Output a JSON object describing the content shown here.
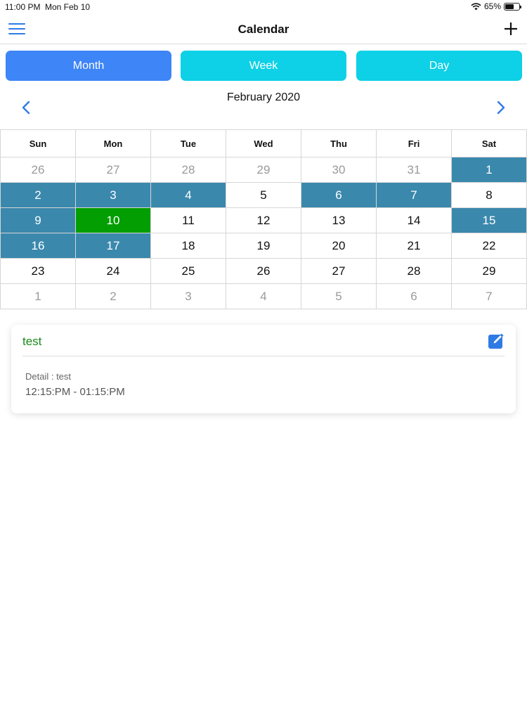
{
  "status_bar": {
    "time": "11:00 PM",
    "date": "Mon Feb 10",
    "battery": "65%",
    "battery_level": 0.65,
    "icons": [
      "wifi-icon",
      "battery-icon"
    ]
  },
  "nav": {
    "title": "Calendar",
    "left_icon": "hamburger-menu-icon",
    "right_icon": "plus-icon"
  },
  "tabs": [
    {
      "label": "Month",
      "selected": true,
      "color": "#3e85f7"
    },
    {
      "label": "Week",
      "selected": false,
      "color": "#0ed0e6"
    },
    {
      "label": "Day",
      "selected": false,
      "color": "#0ed0e6"
    }
  ],
  "month_nav": {
    "title": "February 2020",
    "prev_icon": "chevron-left-icon",
    "next_icon": "chevron-right-icon"
  },
  "calendar": {
    "weekdays": [
      "Sun",
      "Mon",
      "Tue",
      "Wed",
      "Thu",
      "Fri",
      "Sat"
    ],
    "colors": {
      "event": "#3b88ad",
      "today": "#029e02",
      "muted": "#9a9a9a"
    },
    "weeks": [
      [
        {
          "day": "26",
          "state": "muted"
        },
        {
          "day": "27",
          "state": "muted"
        },
        {
          "day": "28",
          "state": "muted"
        },
        {
          "day": "29",
          "state": "muted"
        },
        {
          "day": "30",
          "state": "muted"
        },
        {
          "day": "31",
          "state": "muted"
        },
        {
          "day": "1",
          "state": "event"
        }
      ],
      [
        {
          "day": "2",
          "state": "event"
        },
        {
          "day": "3",
          "state": "event"
        },
        {
          "day": "4",
          "state": "event"
        },
        {
          "day": "5",
          "state": "normal"
        },
        {
          "day": "6",
          "state": "event"
        },
        {
          "day": "7",
          "state": "event"
        },
        {
          "day": "8",
          "state": "normal"
        }
      ],
      [
        {
          "day": "9",
          "state": "event"
        },
        {
          "day": "10",
          "state": "today"
        },
        {
          "day": "11",
          "state": "normal"
        },
        {
          "day": "12",
          "state": "normal"
        },
        {
          "day": "13",
          "state": "normal"
        },
        {
          "day": "14",
          "state": "normal"
        },
        {
          "day": "15",
          "state": "event"
        }
      ],
      [
        {
          "day": "16",
          "state": "event"
        },
        {
          "day": "17",
          "state": "event"
        },
        {
          "day": "18",
          "state": "normal"
        },
        {
          "day": "19",
          "state": "normal"
        },
        {
          "day": "20",
          "state": "normal"
        },
        {
          "day": "21",
          "state": "normal"
        },
        {
          "day": "22",
          "state": "normal"
        }
      ],
      [
        {
          "day": "23",
          "state": "normal"
        },
        {
          "day": "24",
          "state": "normal"
        },
        {
          "day": "25",
          "state": "normal"
        },
        {
          "day": "26",
          "state": "normal"
        },
        {
          "day": "27",
          "state": "normal"
        },
        {
          "day": "28",
          "state": "normal"
        },
        {
          "day": "29",
          "state": "normal"
        }
      ],
      [
        {
          "day": "1",
          "state": "muted"
        },
        {
          "day": "2",
          "state": "muted"
        },
        {
          "day": "3",
          "state": "muted"
        },
        {
          "day": "4",
          "state": "muted"
        },
        {
          "day": "5",
          "state": "muted"
        },
        {
          "day": "6",
          "state": "muted"
        },
        {
          "day": "7",
          "state": "muted"
        }
      ]
    ]
  },
  "event_card": {
    "title": "test",
    "detail": "Detail : test",
    "time": "12:15:PM - 01:15:PM",
    "edit_icon": "edit-icon",
    "title_color": "#1a8a1a"
  }
}
